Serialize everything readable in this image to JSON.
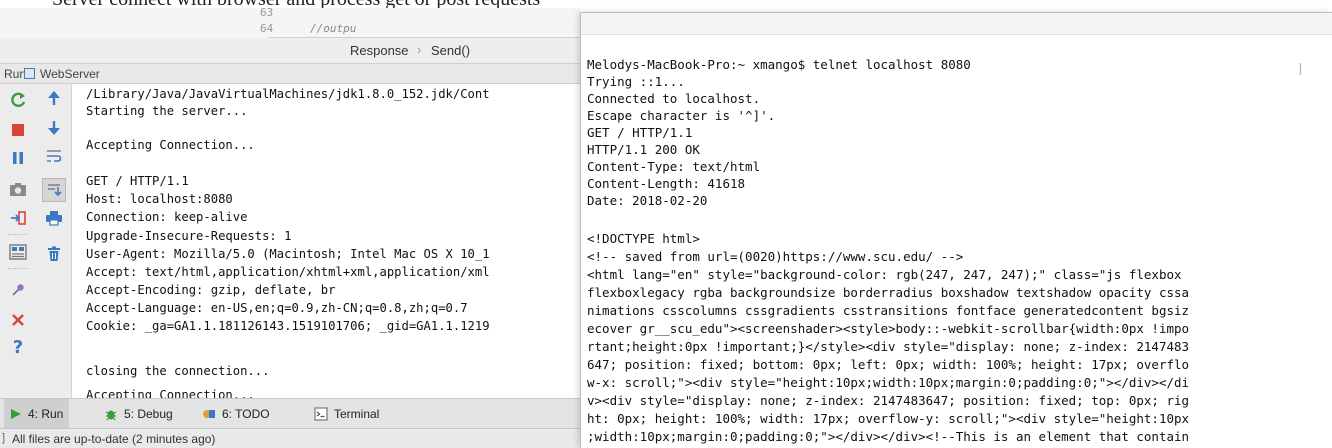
{
  "doc": {
    "snippet": "Server connect with browser and process get or post requests"
  },
  "editor": {
    "lines": [
      {
        "number": "63",
        "code": ""
      },
      {
        "number": "64",
        "code": "//outpu"
      }
    ]
  },
  "breadcrumb": {
    "items": [
      "Response",
      "Send()"
    ]
  },
  "run_panel": {
    "header_label": "Run",
    "config_name": "WebServer"
  },
  "console": {
    "lines": [
      "/Library/Java/JavaVirtualMachines/jdk1.8.0_152.jdk/Cont",
      "Starting the server...",
      "",
      "Accepting Connection...",
      "",
      "GET / HTTP/1.1",
      "Host: localhost:8080",
      "Connection: keep-alive",
      "Upgrade-Insecure-Requests: 1",
      "User-Agent: Mozilla/5.0 (Macintosh; Intel Mac OS X 10_1",
      "Accept: text/html,application/xhtml+xml,application/xml",
      "Accept-Encoding: gzip, deflate, br",
      "Accept-Language: en-US,en;q=0.9,zh-CN;q=0.8,zh;q=0.7",
      "Cookie: _ga=GA1.1.181126143.1519101706; _gid=GA1.1.1219",
      "",
      "closing the connection...",
      "",
      "Accepting Connection..."
    ]
  },
  "tool_tabs": [
    {
      "label": "4: Run",
      "icon": "play-icon",
      "active": true
    },
    {
      "label": "5: Debug",
      "icon": "bug-icon",
      "active": false
    },
    {
      "label": "6: TODO",
      "icon": "todo-icon",
      "active": false
    },
    {
      "label": "Terminal",
      "icon": "terminal-icon",
      "active": false
    }
  ],
  "status_bar": {
    "message": "All files are up-to-date (2 minutes ago)"
  },
  "terminal": {
    "lines": [
      "Melodys-MacBook-Pro:~ xmango$ telnet localhost 8080",
      "Trying ::1...",
      "Connected to localhost.",
      "Escape character is '^]'.",
      "GET / HTTP/1.1",
      "HTTP/1.1 200 OK",
      "Content-Type: text/html",
      "Content-Length: 41618",
      "Date: 2018-02-20",
      "",
      "<!DOCTYPE html>",
      "<!-- saved from url=(0020)https://www.scu.edu/ -->",
      "<html lang=\"en\" style=\"background-color: rgb(247, 247, 247);\" class=\"js flexbox",
      "flexboxlegacy rgba backgroundsize borderradius boxshadow textshadow opacity cssa",
      "nimations csscolumns cssgradients csstransitions fontface generatedcontent bgsiz",
      "ecover gr__scu_edu\"><screenshader><style>body::-webkit-scrollbar{width:0px !impo",
      "rtant;height:0px !important;}</style><div style=\"display: none; z-index: 2147483",
      "647; position: fixed; bottom: 0px; left: 0px; width: 100%; height: 17px; overflo",
      "w-x: scroll;\"><div style=\"height:10px;width:10px;margin:0;padding:0;\"></div></di",
      "v><div style=\"display: none; z-index: 2147483647; position: fixed; top: 0px; rig",
      "ht: 0px; height: 100%; width: 17px; overflow-y: scroll;\"><div style=\"height:10px",
      ";width:10px;margin:0;padding:0;\"></div></div><!--This is an element that contain"
    ]
  },
  "colors": {
    "run_green": "#3c9a3c",
    "stop_red": "#d9443a",
    "action_blue": "#3d78c4",
    "help_blue": "#3d78c4"
  }
}
